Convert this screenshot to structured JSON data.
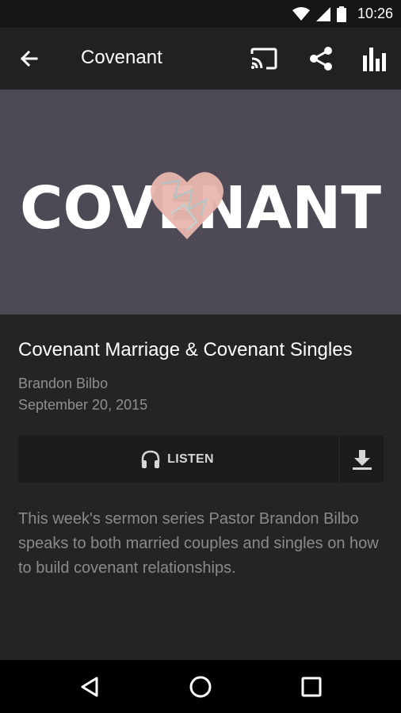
{
  "status_bar": {
    "time": "10:26"
  },
  "app_bar": {
    "title": "Covenant"
  },
  "hero": {
    "wordmark": "COVENANT"
  },
  "sermon": {
    "title": "Covenant Marriage & Covenant Singles",
    "speaker": "Brandon Bilbo",
    "date": "September 20, 2015",
    "listen_label": "LISTEN",
    "description": "This week's sermon series Pastor Brandon Bilbo speaks to both married couples and singles on how to build covenant relationships."
  },
  "colors": {
    "hero_bg": "#4e4a55",
    "heart": "#e7b6ae",
    "background": "#242424"
  }
}
